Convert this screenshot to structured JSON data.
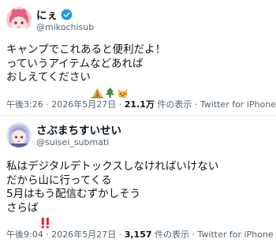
{
  "tweets": [
    {
      "name": "にぇ",
      "handle": "@mikochisub",
      "text": "キャンプでこれあると便利だよ！\nっていうアイテムなどあれば\nおしえてください",
      "emojis": [
        "tent-emoji",
        "tree-emoji",
        "cat-emoji"
      ],
      "time": "午後3:26",
      "date": "2026年5月27日",
      "views": "21.1万",
      "views_label": "件の表示",
      "source": "Twitter for iPhone"
    },
    {
      "name": "さぶまちすいせい",
      "handle": "@suisei_submati",
      "text": "私はデジタルデトックスしなければいけない\nだから山に行ってくる\n5月はもう配信むずかしそう\nさらば",
      "emojis": [
        "double-exclamation-emoji"
      ],
      "time": "午後9:04",
      "date": "2026年5月27日",
      "views": "3,157",
      "views_label": "件の表示",
      "source": "Twitter for iPhone"
    }
  ],
  "sep": "·",
  "colors": {
    "verified": "#1d9bf0",
    "muted": "#536471",
    "text": "#0f1419"
  }
}
